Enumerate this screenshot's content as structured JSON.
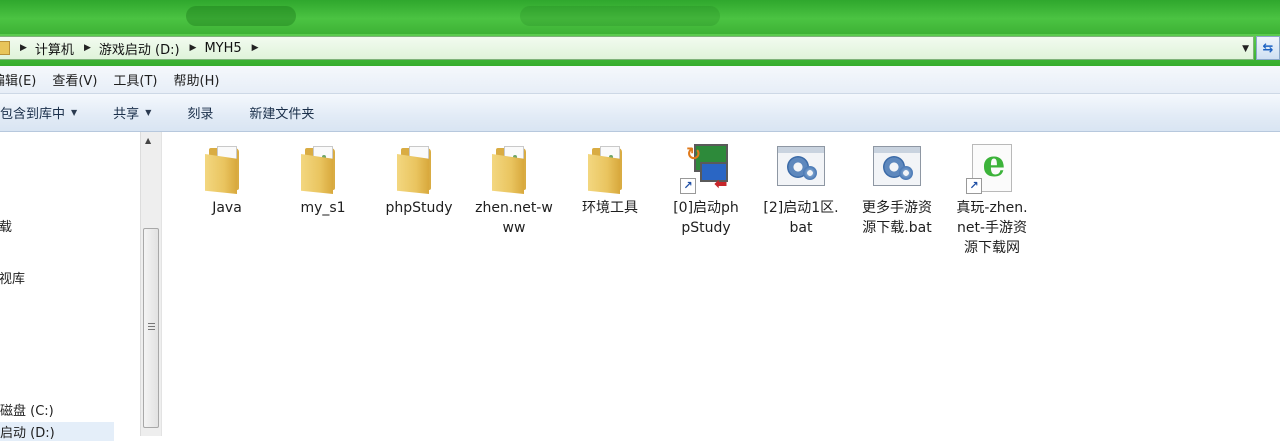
{
  "address": {
    "crumbs": [
      "计算机",
      "游戏启动 (D:)",
      "MYH5"
    ]
  },
  "menu": {
    "items": [
      "编辑(E)",
      "查看(V)",
      "工具(T)",
      "帮助(H)"
    ]
  },
  "toolbar": {
    "include_library": "包含到库中",
    "share": "共享",
    "burn": "刻录",
    "new_folder": "新建文件夹"
  },
  "nav": {
    "items": [
      "下载",
      "影视库",
      "本地磁盘 (C:)",
      "游戏启动 (D:)"
    ]
  },
  "files": [
    {
      "label": "Java",
      "type": "folder"
    },
    {
      "label": "my_s1",
      "type": "folder"
    },
    {
      "label": "phpStudy",
      "type": "folder"
    },
    {
      "label": "zhen.net-www",
      "type": "folder"
    },
    {
      "label": "环境工具",
      "type": "folder"
    },
    {
      "label": "[0]启动phpStudy",
      "type": "shortcut"
    },
    {
      "label": "[2]启动1区.bat",
      "type": "bat"
    },
    {
      "label": "更多手游资源下载.bat",
      "type": "bat"
    },
    {
      "label": "真玩-zhen.net-手游资源下载网",
      "type": "url"
    }
  ],
  "colors": {
    "frame_green": "#3db235",
    "toolbar_blue": "#e2ebf6",
    "folder_yellow": "#e9c45f"
  }
}
